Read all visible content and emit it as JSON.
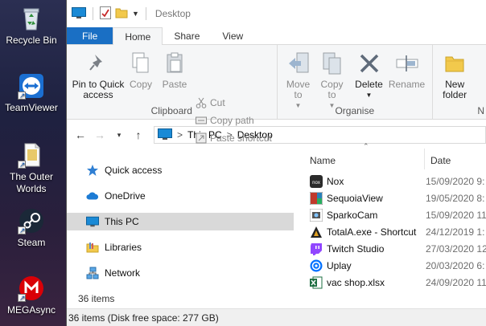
{
  "desktop": {
    "icons": [
      {
        "label": "Recycle Bin",
        "icon": "recycle-bin-icon"
      },
      {
        "label": "TeamViewer",
        "icon": "teamviewer-icon"
      },
      {
        "label": "The Outer Worlds",
        "icon": "file-shortcut-icon"
      },
      {
        "label": "Steam",
        "icon": "steam-icon"
      },
      {
        "label": "MEGAsync",
        "icon": "megasync-icon"
      }
    ]
  },
  "window": {
    "title": "Desktop",
    "tabs": [
      "File",
      "Home",
      "Share",
      "View"
    ],
    "ribbon": {
      "clipboard": {
        "group_label": "Clipboard",
        "pin_label": "Pin to Quick access",
        "copy_label": "Copy",
        "paste_label": "Paste",
        "cut_label": "Cut",
        "copy_path_label": "Copy path",
        "paste_shortcut_label": "Paste shortcut"
      },
      "organise": {
        "group_label": "Organise",
        "move_to_label": "Move to",
        "copy_to_label": "Copy to",
        "delete_label": "Delete",
        "rename_label": "Rename"
      },
      "new": {
        "group_label": "N",
        "new_folder_label": "New folder"
      }
    },
    "address": {
      "crumbs": [
        "This PC",
        "Desktop"
      ],
      "separator": ">"
    },
    "nav_pane": {
      "items": [
        {
          "label": "Quick access",
          "icon": "star-icon"
        },
        {
          "label": "OneDrive",
          "icon": "cloud-icon"
        },
        {
          "label": "This PC",
          "icon": "monitor-icon",
          "selected": true
        },
        {
          "label": "Libraries",
          "icon": "library-icon"
        },
        {
          "label": "Network",
          "icon": "network-icon"
        }
      ]
    },
    "file_list": {
      "columns": {
        "name": "Name",
        "date": "Date"
      },
      "rows": [
        {
          "name": "Nox",
          "date": "15/09/2020 9:",
          "icon": "nox-icon"
        },
        {
          "name": "SequoiaView",
          "date": "19/05/2020 8:",
          "icon": "sequoiaview-icon"
        },
        {
          "name": "SparkoCam",
          "date": "15/09/2020 11",
          "icon": "sparkocam-icon"
        },
        {
          "name": "TotalA.exe - Shortcut",
          "date": "24/12/2019 1:",
          "icon": "totala-icon"
        },
        {
          "name": "Twitch Studio",
          "date": "27/03/2020 12",
          "icon": "twitch-icon"
        },
        {
          "name": "Uplay",
          "date": "20/03/2020 6:",
          "icon": "uplay-icon"
        },
        {
          "name": "vac shop.xlsx",
          "date": "24/09/2020 11",
          "icon": "excel-icon"
        }
      ]
    },
    "item_count": "36 items",
    "status_bar": "36 items (Disk free space: 277 GB)"
  },
  "colors": {
    "file_tab": "#1a6fc4",
    "selected_nav": "#d9d9d9",
    "ribbon_bg": "#f5f6f7"
  }
}
